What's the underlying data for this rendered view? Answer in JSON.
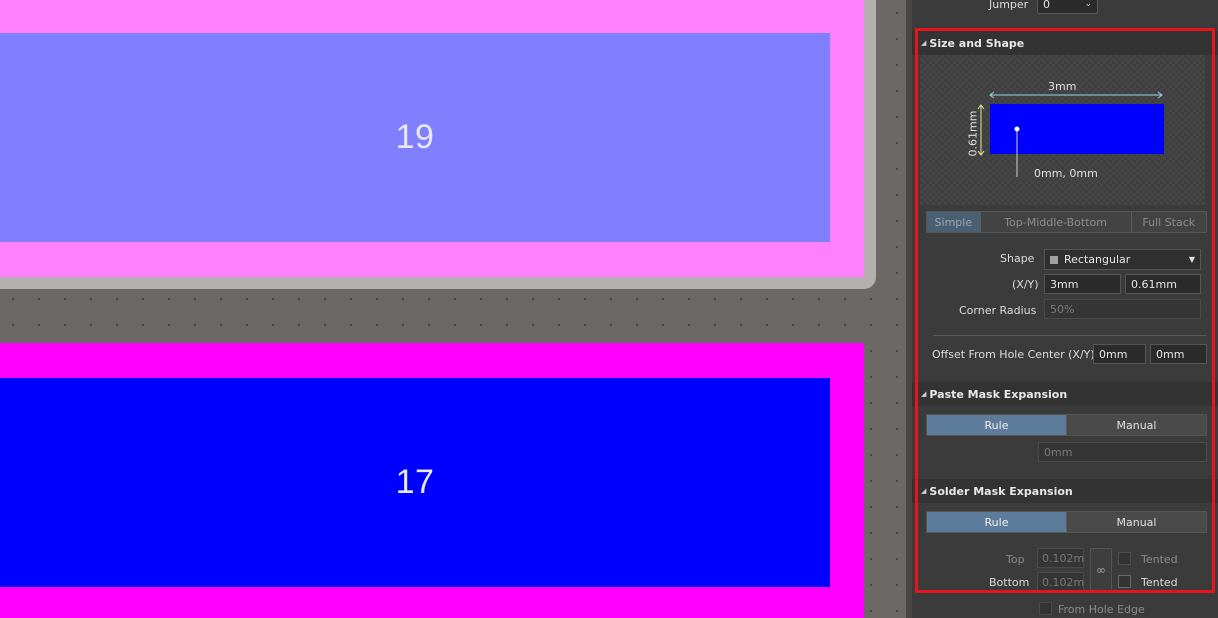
{
  "canvas": {
    "pad_top_label": "19",
    "pad_bottom_label": "17"
  },
  "panel": {
    "jumper": {
      "label": "Jumper",
      "value": "0"
    },
    "size_shape": {
      "header": "Size and Shape",
      "preview": {
        "width_label": "3mm",
        "height_label": "0.61mm",
        "origin_label": "0mm, 0mm",
        "pad_color": "#0000ff"
      },
      "modes": [
        "Simple",
        "Top-Middle-Bottom",
        "Full Stack"
      ],
      "active_mode": "Simple",
      "shape_label": "Shape",
      "shape_value": "Rectangular",
      "xy_label": "(X/Y)",
      "x_value": "3mm",
      "y_value": "0.61mm",
      "corner_label": "Corner Radius",
      "corner_value": "50%",
      "offset_label": "Offset From Hole Center (X/Y)",
      "offset_x": "0mm",
      "offset_y": "0mm"
    },
    "paste_mask": {
      "header": "Paste Mask Expansion",
      "options": [
        "Rule",
        "Manual"
      ],
      "active": "Rule",
      "value": "0mm"
    },
    "solder_mask": {
      "header": "Solder Mask Expansion",
      "options": [
        "Rule",
        "Manual"
      ],
      "active": "Rule",
      "top_label": "Top",
      "top_value": "0.102m",
      "bottom_label": "Bottom",
      "bottom_value": "0.102m",
      "tented_top": "Tented",
      "tented_bottom": "Tented",
      "from_hole_edge": "From Hole Edge"
    }
  },
  "colors": {
    "highlight": "#e8141c",
    "active_button": "#5d7c9c",
    "pad19_mask": "#ff80ff",
    "pad19": "#8080ff",
    "pad17_mask": "#ff00ff",
    "pad17": "#0000ff"
  }
}
